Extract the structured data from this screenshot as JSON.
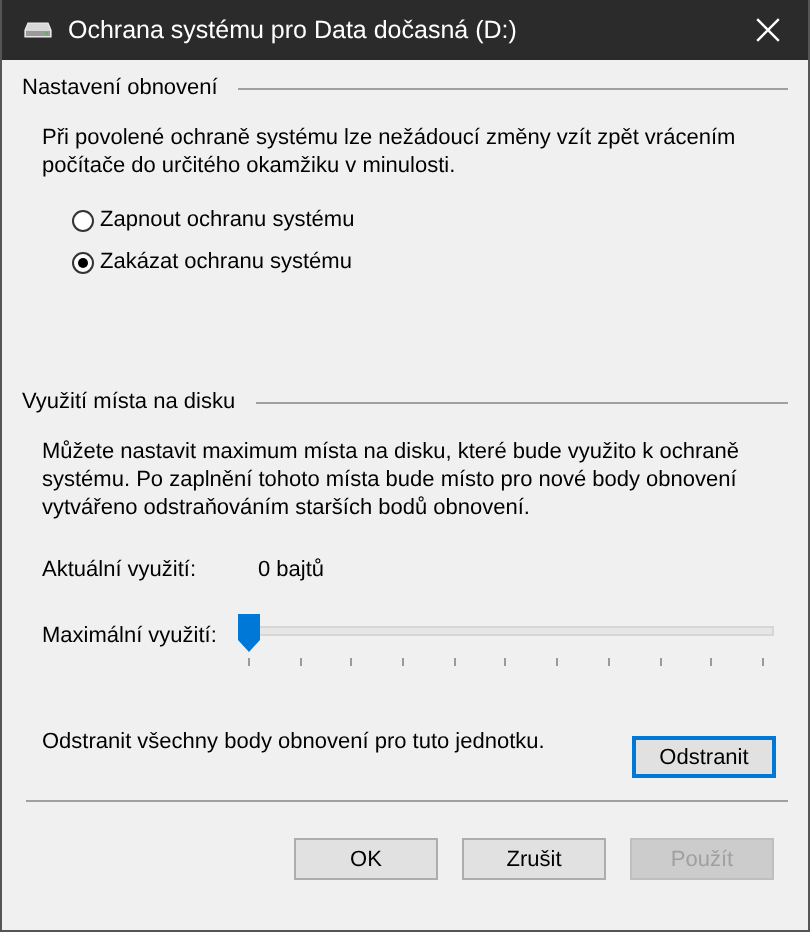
{
  "window": {
    "title": "Ochrana systému pro Data dočasná (D:)"
  },
  "restore_settings": {
    "heading": "Nastavení obnovení",
    "description": "Při povolené ochraně systému lze nežádoucí změny vzít zpět vrácením počítače do určitého okamžiku v minulosti.",
    "options": [
      {
        "label": "Zapnout ochranu systému",
        "selected": false
      },
      {
        "label": "Zakázat ochranu systému",
        "selected": true
      }
    ]
  },
  "disk_usage": {
    "heading": "Využití místa na disku",
    "description": "Můžete nastavit maximum místa na disku, které bude využito k ochraně systému. Po zaplnění tohoto místa bude místo pro nové body obnovení vytvářeno odstraňováním starších bodů obnovení.",
    "current_label": "Aktuální využití:",
    "current_value": "0 bajtů",
    "max_label": "Maximální využití:",
    "max_slider": {
      "level": 0
    },
    "delete_text": "Odstranit všechny body obnovení pro tuto jednotku.",
    "delete_button": {
      "label": "Odstranit",
      "focused": true
    }
  },
  "buttons": [
    {
      "label": "OK",
      "disabled": false
    },
    {
      "label": "Zrušit",
      "disabled": false
    },
    {
      "label": "Použít",
      "disabled": true
    }
  ]
}
